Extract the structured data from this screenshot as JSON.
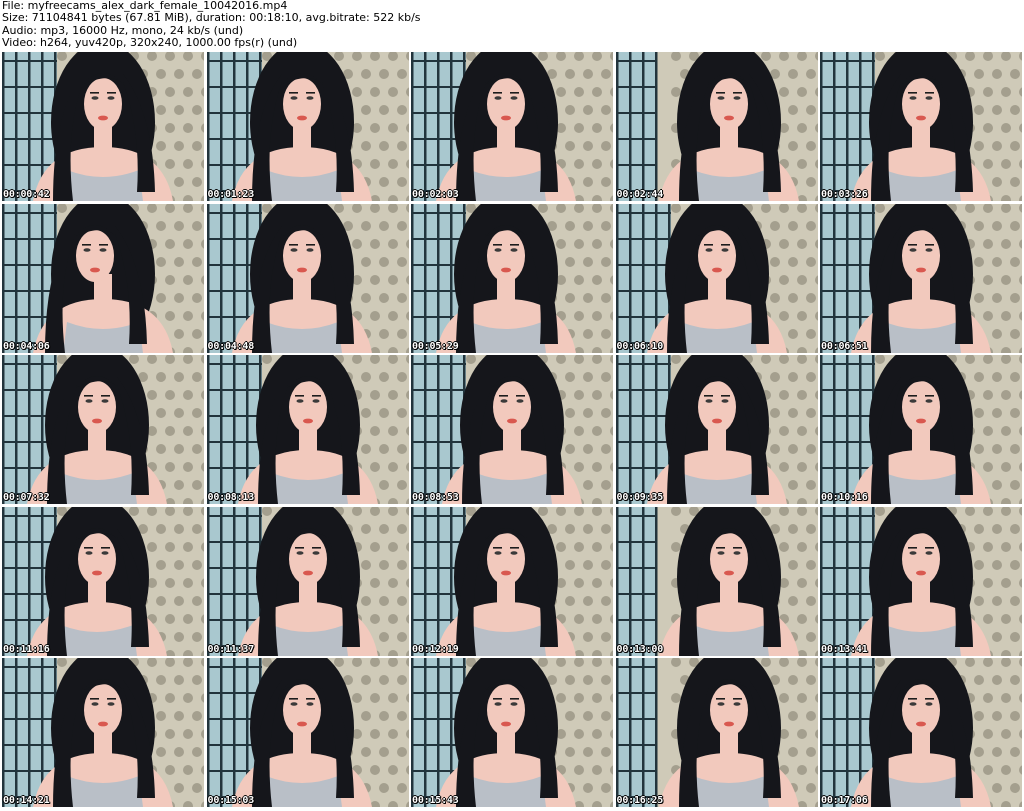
{
  "info": {
    "file_line": "File: myfreecams_alex_dark_female_10042016.mp4",
    "size_line": "Size: 71104841 bytes (67.81 MiB), duration: 00:18:10, avg.bitrate: 522 kb/s",
    "audio_line": "Audio: mp3, 16000 Hz, mono, 24 kb/s (und)",
    "video_line": "Video: h264, yuv420p, 320x240, 1000.00 fps(r) (und)"
  },
  "colors": {
    "screen_light": "#a9c8cf",
    "screen_frame": "#22343c",
    "sofa": "#cfcab8",
    "pattern": "#6e6a5c",
    "hair": "#15161b",
    "skin": "#f2c9bd",
    "top": "#b9bfc7"
  },
  "thumbnails": [
    {
      "time": "00:00:42",
      "pose": 0
    },
    {
      "time": "00:01:23",
      "pose": 1
    },
    {
      "time": "00:02:03",
      "pose": 1
    },
    {
      "time": "00:02:44",
      "pose": 2
    },
    {
      "time": "00:03:26",
      "pose": 0
    },
    {
      "time": "00:04:06",
      "pose": 3
    },
    {
      "time": "00:04:48",
      "pose": 1
    },
    {
      "time": "00:05:29",
      "pose": 1
    },
    {
      "time": "00:06:10",
      "pose": 0
    },
    {
      "time": "00:06:51",
      "pose": 0
    },
    {
      "time": "00:07:32",
      "pose": 1
    },
    {
      "time": "00:08:13",
      "pose": 0
    },
    {
      "time": "00:08:53",
      "pose": 0
    },
    {
      "time": "00:09:35",
      "pose": 0
    },
    {
      "time": "00:10:16",
      "pose": 0
    },
    {
      "time": "00:11:16",
      "pose": 1
    },
    {
      "time": "00:11:37",
      "pose": 0
    },
    {
      "time": "00:12:19",
      "pose": 1
    },
    {
      "time": "00:13:00",
      "pose": 2
    },
    {
      "time": "00:13:41",
      "pose": 0
    },
    {
      "time": "00:14:21",
      "pose": 0
    },
    {
      "time": "00:15:03",
      "pose": 1
    },
    {
      "time": "00:15:43",
      "pose": 1
    },
    {
      "time": "00:16:25",
      "pose": 2
    },
    {
      "time": "00:17:06",
      "pose": 0
    }
  ]
}
